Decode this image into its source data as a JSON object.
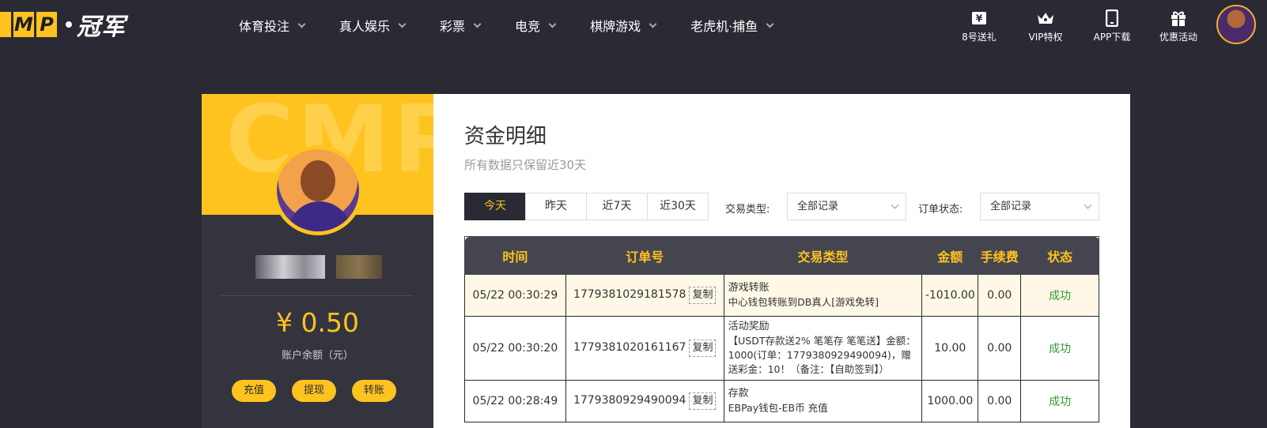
{
  "logo": {
    "letters": [
      "MP"
    ],
    "box": [
      "",
      "M",
      "P"
    ],
    "cn": "冠军"
  },
  "nav": [
    {
      "label": "体育投注"
    },
    {
      "label": "真人娱乐"
    },
    {
      "label": "彩票"
    },
    {
      "label": "电竞"
    },
    {
      "label": "棋牌游戏"
    },
    {
      "label": "老虎机·捕鱼"
    }
  ],
  "top_right": [
    {
      "label": "8号送礼",
      "icon": "yen-ticket-icon"
    },
    {
      "label": "VIP特权",
      "icon": "crown-icon"
    },
    {
      "label": "APP下载",
      "icon": "phone-icon"
    },
    {
      "label": "优惠活动",
      "icon": "gift-icon"
    }
  ],
  "profile": {
    "watermark": "CMP",
    "balance": "¥ 0.50",
    "balance_label": "账户余额（元）",
    "buttons": {
      "deposit": "充值",
      "withdraw": "提现",
      "transfer": "转账"
    }
  },
  "main": {
    "title": "资金明细",
    "subtitle": "所有数据只保留近30天",
    "tabs": [
      "今天",
      "昨天",
      "近7天",
      "近30天"
    ],
    "active_tab": "今天",
    "filter_type_label": "交易类型:",
    "filter_type_value": "全部记录",
    "filter_status_label": "订单状态:",
    "filter_status_value": "全部记录"
  },
  "table": {
    "headers": [
      "时间",
      "订单号",
      "交易类型",
      "金额",
      "手续费",
      "状态"
    ],
    "copy_label": "复制",
    "rows": [
      {
        "time": "05/22 00:30:29",
        "order": "1779381029181578",
        "type_title": "游戏转账",
        "type_desc": "中心钱包转账到DB真人[游戏免转]",
        "amount": "-1010.00",
        "fee": "0.00",
        "status": "成功"
      },
      {
        "time": "05/22 00:30:20",
        "order": "1779381020161167",
        "type_title": "活动奖励",
        "type_desc": "【USDT存款送2% 笔笔存 笔笔送】金额：1000(订单：1779380929490094)，赠送彩金：10！（备注：【自助签到】）",
        "amount": "10.00",
        "fee": "0.00",
        "status": "成功"
      },
      {
        "time": "05/22 00:28:49",
        "order": "1779380929490094",
        "type_title": "存款",
        "type_desc": "EBPay钱包-EB币 充值",
        "amount": "1000.00",
        "fee": "0.00",
        "status": "成功"
      }
    ]
  },
  "colors": {
    "accent": "#ffc31f",
    "dark": "#292a33",
    "success": "#2f9a2f"
  }
}
